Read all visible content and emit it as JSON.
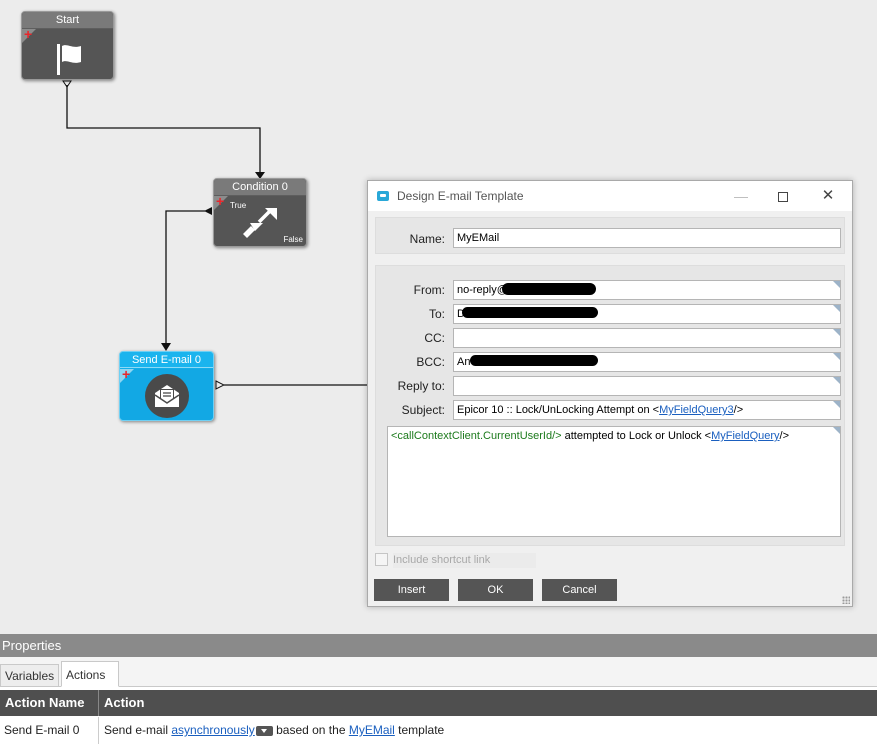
{
  "canvas": {
    "nodes": {
      "start": {
        "title": "Start",
        "icon": "flag-icon"
      },
      "condition": {
        "title": "Condition 0",
        "true_label": "True",
        "false_label": "False",
        "icon": "redirect-arrow-icon"
      },
      "send_email": {
        "title": "Send E-mail 0",
        "icon": "envelope-icon"
      }
    }
  },
  "dialog": {
    "title": "Design E-mail Template",
    "name_label": "Name:",
    "name_value": "MyEMail",
    "from_label": "From:",
    "from_value": "no-reply@",
    "to_label": "To:",
    "to_value": "D",
    "cc_label": "CC:",
    "cc_value": "",
    "bcc_label": "BCC:",
    "bcc_value": "An",
    "reply_to_label": "Reply to:",
    "reply_to_value": "",
    "subject_label": "Subject:",
    "subject_prefix": "Epicor 10 :: Lock/UnLocking Attempt on <",
    "subject_link": "MyFieldQuery3",
    "subject_suffix": "/>",
    "body_tag": "<callContextClient.CurrentUserId/>",
    "body_middle": " attempted to Lock or Unlock <",
    "body_link": "MyFieldQuery",
    "body_suffix": "/>",
    "include_shortcut_label": "Include shortcut link",
    "insert_button": "Insert",
    "ok_button": "OK",
    "cancel_button": "Cancel"
  },
  "properties": {
    "header": "Properties",
    "tabs": [
      "Variables",
      "Actions"
    ],
    "active_tab": "Actions",
    "columns": [
      "Action Name",
      "Action"
    ],
    "rows": [
      {
        "name": "Send E-mail 0",
        "action_prefix": "Send e-mail ",
        "action_link1": "asynchronously",
        "action_middle": " based on the ",
        "action_link2": "MyEMail",
        "action_suffix": " template"
      }
    ]
  },
  "colors": {
    "node_grey": "#5e5e5e",
    "node_blue": "#12aee8",
    "button_dark": "#555555",
    "link": "#1a5fbf",
    "grid_header": "#4f4f4f"
  }
}
